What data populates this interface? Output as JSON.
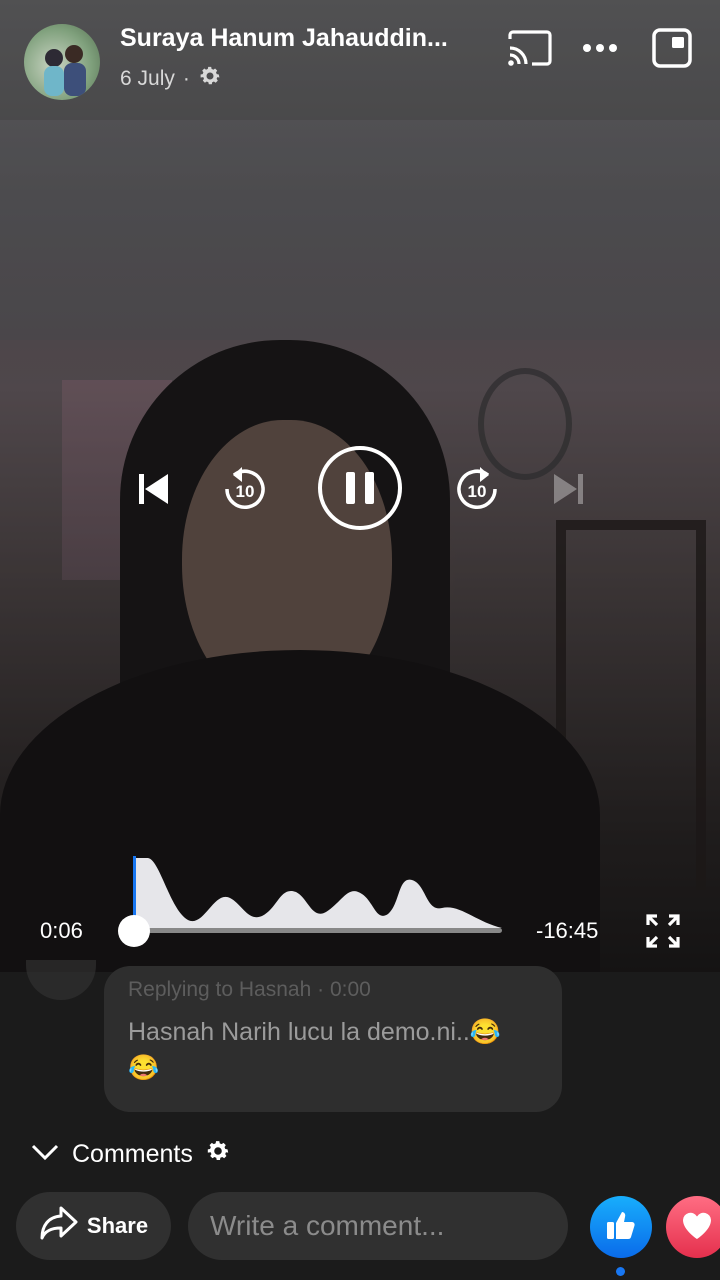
{
  "post": {
    "author": "Suraya Hanum Jahauddin...",
    "date": "6 July",
    "separator": "·"
  },
  "player": {
    "elapsed": "0:06",
    "remaining": "-16:45",
    "progress_fraction": 0.006,
    "state": "playing"
  },
  "comment": {
    "replying_to": "Replying to Hasnah",
    "reply_time": "0:00",
    "meta_separator": "·",
    "author": "Hasnah Narih",
    "text": "lucu la demo.ni..",
    "emoji_1": "😂",
    "emoji_2": "😂"
  },
  "comments_section": {
    "label": "Comments"
  },
  "actions": {
    "share_label": "Share",
    "comment_placeholder": "Write a comment..."
  },
  "colors": {
    "like_blue": "#0a6bea",
    "love_red": "#e5304d"
  }
}
